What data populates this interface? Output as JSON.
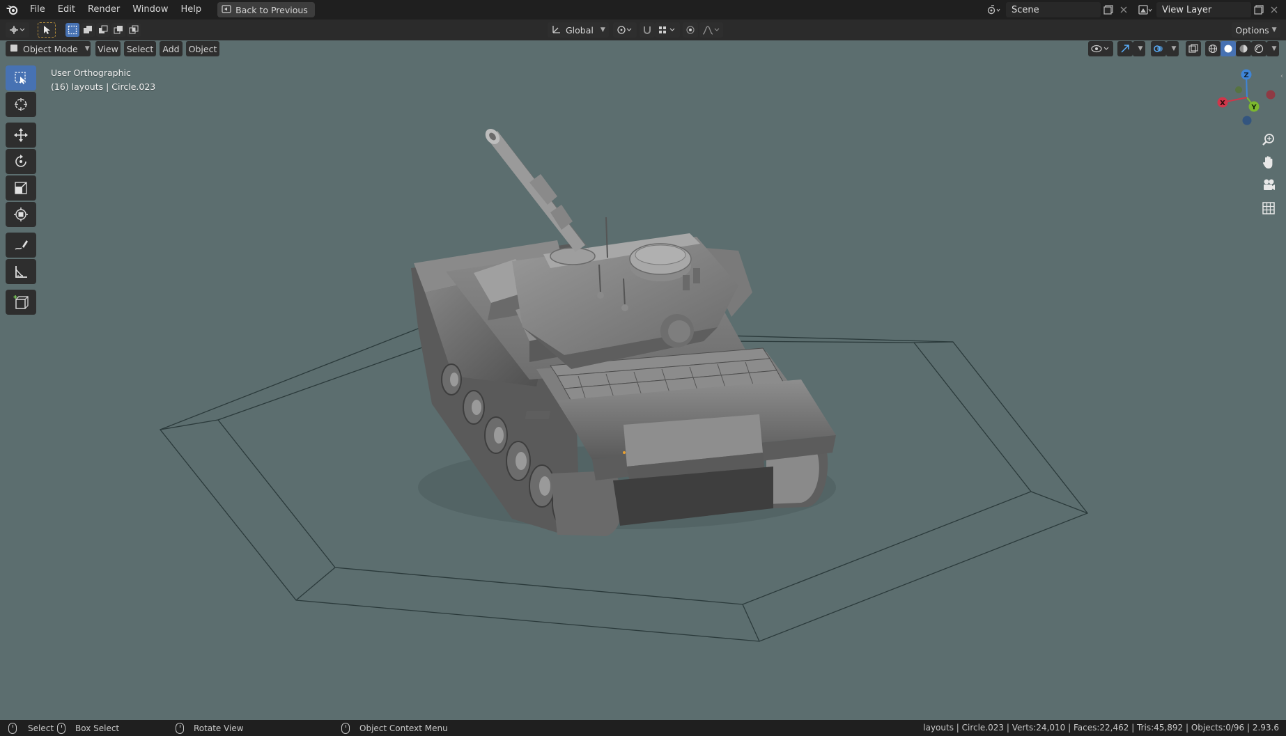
{
  "topbar": {
    "menus": [
      "File",
      "Edit",
      "Render",
      "Window",
      "Help"
    ],
    "back_button": "Back to Previous",
    "scene_label": "Scene",
    "view_layer_label": "View Layer"
  },
  "header": {
    "transform_orientation": "Global",
    "options_label": "Options"
  },
  "viewport_header": {
    "mode": "Object Mode",
    "menus": [
      "View",
      "Select",
      "Add",
      "Object"
    ]
  },
  "viewport": {
    "view_name": "User Orthographic",
    "collection_info": "(16) layouts | Circle.023",
    "background_color": "#5c6e6f"
  },
  "gizmo": {
    "axis_z": "Z",
    "axis_y": "Y",
    "axis_x": "X",
    "x_color": "#d0364a",
    "y_color": "#7cb82e",
    "z_color": "#3f85d8"
  },
  "toolbar": {
    "tools": [
      "select-box",
      "cursor",
      "move",
      "rotate",
      "scale",
      "transform",
      "annotate",
      "measure",
      "add-cube"
    ]
  },
  "statusbar": {
    "select": "Select",
    "box_select": "Box Select",
    "rotate_view": "Rotate View",
    "context_menu": "Object Context Menu",
    "stats": "layouts | Circle.023 | Verts:24,010 | Faces:22,462 | Tris:45,892 | Objects:0/96 | 2.93.6"
  },
  "accent_color": "#4772b3"
}
